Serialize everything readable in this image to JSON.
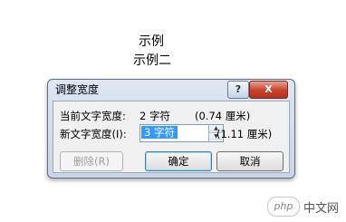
{
  "document": {
    "line1": "示例",
    "line2": "示例二"
  },
  "dialog": {
    "title": "调整宽度",
    "help_label": "?",
    "close_label": "X",
    "current_width_label": "当前文字宽度:",
    "current_width_value": "2 字符",
    "current_width_cm": "(0.74 厘米)",
    "new_width_label": "新文字宽度(I):",
    "new_width_value": "3 字符",
    "new_width_cm": "(1.11 厘米)",
    "spin_up": "▲",
    "spin_down": "▼",
    "delete_label": "删除(R)",
    "ok_label": "确定",
    "cancel_label": "取消"
  },
  "watermark": {
    "logo_text": "php",
    "text": "中文网"
  }
}
